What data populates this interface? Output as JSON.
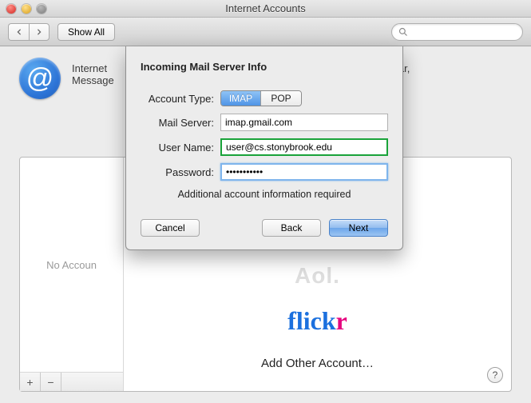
{
  "window": {
    "title": "Internet Accounts"
  },
  "toolbar": {
    "show_all": "Show All",
    "search_placeholder": ""
  },
  "main": {
    "summary_prefix": "Internet",
    "summary_suffix": "Calendar,",
    "summary_line2": "Message",
    "sidebar_empty": "No Accoun",
    "services": {
      "aol": "Aol.",
      "flickr": "flickr",
      "add_other": "Add Other Account…"
    }
  },
  "sheet": {
    "title": "Incoming Mail Server Info",
    "labels": {
      "account_type": "Account Type:",
      "mail_server": "Mail Server:",
      "user_name": "User Name:",
      "password": "Password:"
    },
    "account_type": {
      "options": [
        "IMAP",
        "POP"
      ],
      "selected": "IMAP"
    },
    "fields": {
      "mail_server": "imap.gmail.com",
      "user_name": "user@cs.stonybrook.edu",
      "password": "•••••••••••"
    },
    "status": "Additional account information required",
    "buttons": {
      "cancel": "Cancel",
      "back": "Back",
      "next": "Next"
    }
  }
}
